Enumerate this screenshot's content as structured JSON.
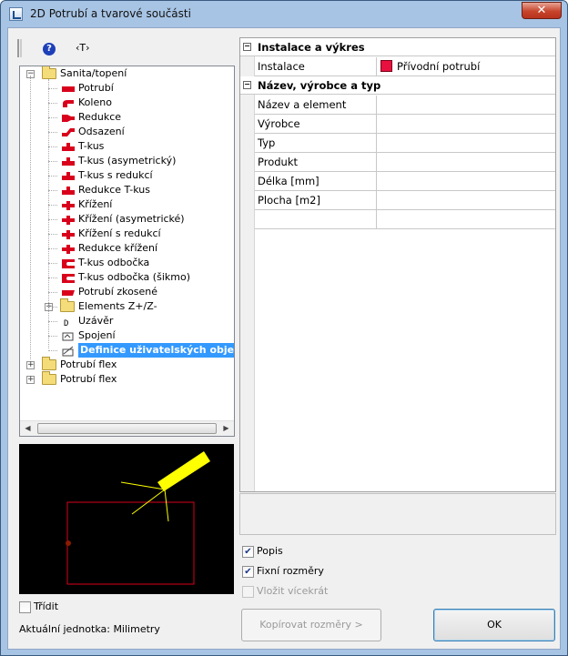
{
  "window": {
    "title": "2D Potrubí a tvarové součásti",
    "close_label": "✕"
  },
  "toolbar": {
    "help_label": "?",
    "text_label": "‹T›"
  },
  "tree": {
    "root": "Sanita/topení",
    "items": [
      {
        "label": "Potrubí",
        "icon": "pipe-icon"
      },
      {
        "label": "Koleno",
        "icon": "elbow-icon"
      },
      {
        "label": "Redukce",
        "icon": "reducer-icon"
      },
      {
        "label": "Odsazení",
        "icon": "offset-icon"
      },
      {
        "label": "T-kus",
        "icon": "tee-icon"
      },
      {
        "label": "T-kus (asymetrický)",
        "icon": "tee-asym-icon"
      },
      {
        "label": "T-kus s redukcí",
        "icon": "tee-reducing-icon"
      },
      {
        "label": "Redukce T-kus",
        "icon": "reducer-tee-icon"
      },
      {
        "label": "Křížení",
        "icon": "cross-icon"
      },
      {
        "label": "Křížení (asymetrické)",
        "icon": "cross-asym-icon"
      },
      {
        "label": "Křížení s redukcí",
        "icon": "cross-reducing-icon"
      },
      {
        "label": "Redukce křížení",
        "icon": "reducer-cross-icon"
      },
      {
        "label": "T-kus odbočka",
        "icon": "branch-tee-icon"
      },
      {
        "label": "T-kus odbočka (šikmo)",
        "icon": "branch-tee-oblique-icon"
      },
      {
        "label": "Potrubí zkosené",
        "icon": "bevelled-pipe-icon"
      },
      {
        "label": "Elements Z+/Z-",
        "icon": "folder-icon"
      },
      {
        "label": "Uzávěr",
        "icon": "cap-icon"
      },
      {
        "label": "Spojení",
        "icon": "join-icon"
      },
      {
        "label": "Definice uživatelských objektů",
        "icon": "user-object-icon"
      }
    ],
    "others": [
      "Potrubí flex",
      "Potrubí flex"
    ]
  },
  "options": {
    "sort_label": "Třídit",
    "unit_text": "Aktuální jednotka: Milimetry"
  },
  "properties": {
    "section1": {
      "title": "Instalace a výkres",
      "rows": [
        {
          "key": "Instalace",
          "value": "Přívodní potrubí",
          "color": "#e8103f"
        }
      ]
    },
    "section2": {
      "title": "Název, výrobce a typ",
      "rows": [
        "Název a element",
        "Výrobce",
        "Typ",
        "Produkt",
        "Délka [mm]",
        "Plocha [m2]",
        ""
      ]
    }
  },
  "checks": {
    "label": "Popis",
    "fixed": "Fixní rozměry",
    "multi": "Vložit vícekrát"
  },
  "buttons": {
    "copy": "Kopírovat rozměry >",
    "ok": "OK"
  },
  "colors": {
    "accent": "#3399ff",
    "pipe": "#d9001b",
    "preview_bg": "#000000"
  }
}
